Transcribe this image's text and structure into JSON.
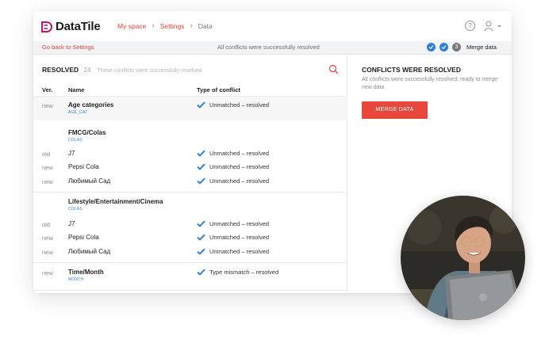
{
  "app": {
    "name": "DataTile"
  },
  "breadcrumb": [
    "My space",
    "Settings",
    "Data"
  ],
  "subbar": {
    "back": "Go back to Settings",
    "status": "All conflicts were successfully resolved",
    "step_number": "3",
    "step_label": "Merge data"
  },
  "resolved": {
    "title": "RESOLVED",
    "count": "24",
    "description": "These conflicts were successfully resolved"
  },
  "table": {
    "headers": {
      "ver": "Ver.",
      "name": "Name",
      "type": "Type of conflict"
    },
    "rows": [
      {
        "ver": "new",
        "name": "Age categories",
        "sub": "AGE_CAT",
        "type": "Unmatched – resolved"
      },
      {
        "ver": "",
        "name": "FMCG/Colas",
        "sub": "COLAS",
        "type": ""
      },
      {
        "ver": "old",
        "name": "J7",
        "sub": "",
        "type": "Unmatched – resolved"
      },
      {
        "ver": "new",
        "name": "Pepsi Cola",
        "sub": "",
        "type": "Unmatched – resolved"
      },
      {
        "ver": "new",
        "name": "Любимый Сад",
        "sub": "",
        "type": "Unmatched – resolved"
      },
      {
        "ver": "",
        "name": "Lifestyle/Entertainment/Cinema",
        "sub": "COLAS",
        "type": ""
      },
      {
        "ver": "old",
        "name": "J7",
        "sub": "",
        "type": "Unmatched – resolved"
      },
      {
        "ver": "new",
        "name": "Pepsi Cola",
        "sub": "",
        "type": "Unmatched – resolved"
      },
      {
        "ver": "new",
        "name": "Любимый Сад",
        "sub": "",
        "type": "Unmatched – resolved"
      },
      {
        "ver": "new",
        "name": "Time/Month",
        "sub": "MONTH",
        "type": "Type mismatch – resolved"
      }
    ]
  },
  "conflicts": {
    "title": "CONFLICTS WERE RESOLVED",
    "description": "All conflicts were successfully resolved, ready to merge new data",
    "button": "MERGE DATA"
  },
  "colors": {
    "accent": "#e8483b",
    "blue": "#2f80d8"
  },
  "icons": [
    "datatile-logo-icon",
    "chevron-right-icon",
    "help-icon",
    "user-icon",
    "chevron-down-icon",
    "check-circle-icon",
    "search-icon",
    "checkmark-icon"
  ]
}
